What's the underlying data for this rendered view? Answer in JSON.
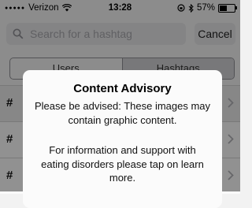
{
  "status_bar": {
    "signal": "●●●●●",
    "carrier": "Verizon",
    "time": "13:28",
    "battery": "57%",
    "battery_level": 0.57
  },
  "search": {
    "placeholder": "Search for a hashtag",
    "cancel_label": "Cancel"
  },
  "tabs": [
    {
      "label": "Users",
      "active": false
    },
    {
      "label": "Hashtags",
      "active": true
    }
  ],
  "list": {
    "items": [
      {
        "glyph": "#"
      },
      {
        "glyph": "#"
      },
      {
        "glyph": "#"
      }
    ]
  },
  "alert": {
    "title": "Content Advisory",
    "message_1": "Please be advised: These images may contain graphic content.",
    "message_2": "For information and support with eating disorders please tap on learn more."
  }
}
